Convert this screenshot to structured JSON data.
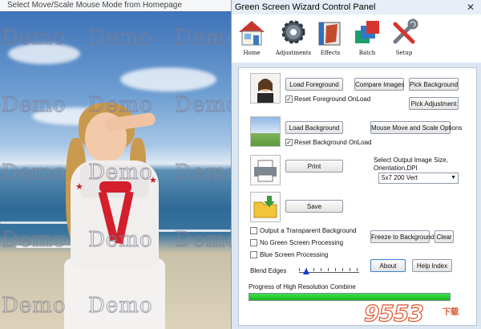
{
  "preview": {
    "title": "Select Move/Scale Mouse Mode from Homepage",
    "watermark_text": "Demo"
  },
  "panel": {
    "title": "Green Screen Wizard Control Panel",
    "close_glyph": "✕",
    "toolbar": [
      {
        "label": "Home",
        "icon": "home-icon"
      },
      {
        "label": "Adjustments",
        "icon": "gear-icon"
      },
      {
        "label": "Effects",
        "icon": "book-icon"
      },
      {
        "label": "Batch",
        "icon": "layers-icon"
      },
      {
        "label": "Setup",
        "icon": "tools-icon"
      }
    ],
    "buttons": {
      "load_foreground": "Load Foreground",
      "compare_images": "Compare Images",
      "pick_background": "Pick Background",
      "pick_adjustment": "Pick Adjustment",
      "load_background": "Load Background",
      "mouse_move_scale": "Mouse Move and Scale Options",
      "print": "Print",
      "save": "Save",
      "freeze_background": "Freeze to Background",
      "clear": "Clear",
      "about": "About",
      "help_index": "Help Index"
    },
    "checkboxes": {
      "reset_foreground": {
        "label": "Reset Foreground OnLoad",
        "checked": true
      },
      "reset_background": {
        "label": "Reset Background OnLoad",
        "checked": true
      },
      "transparent_bg": {
        "label": "Output a Transparent Background",
        "checked": false
      },
      "no_green": {
        "label": "No Green Screen Processing",
        "checked": false
      },
      "blue_screen": {
        "label": "Blue Screen Processing",
        "checked": false
      }
    },
    "output_size_label": "Select Output Image Size, Orientation,DPI",
    "output_size_value": "5x7 200 Vert",
    "blend_edges_label": "Blend Edges",
    "blend_edges_level": 0.12,
    "progress_label": "Progress of High Resolution Combine",
    "progress_fraction": 1.0
  },
  "site_watermark": {
    "text": "9553",
    "sub": "下载"
  }
}
